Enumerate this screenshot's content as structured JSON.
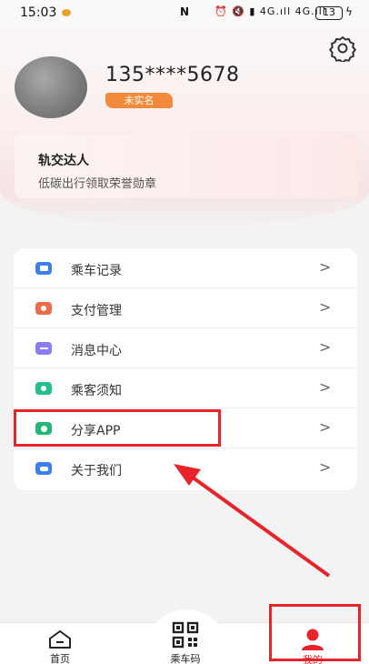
{
  "status_bar": {
    "time": "15:03",
    "nfc": "N",
    "icons": "⏰ 🔇 ▮ 4G.ıll 4G.ıll",
    "battery": "13",
    "bolt": "ϟ"
  },
  "profile": {
    "phone": "135****5678",
    "verify_badge": "未实名",
    "settings_icon": "gear-icon"
  },
  "honor_card": {
    "title": "轨交达人",
    "subtitle": "低碳出行领取荣誉勋章"
  },
  "menu": {
    "items": [
      {
        "label": "乘车记录",
        "icon": "ride-record-icon",
        "color": "#3b7ff0"
      },
      {
        "label": "支付管理",
        "icon": "payment-icon",
        "color": "#ee6b4a"
      },
      {
        "label": "消息中心",
        "icon": "message-icon",
        "color": "#8a7cf2"
      },
      {
        "label": "乘客须知",
        "icon": "notice-icon",
        "color": "#22c08a"
      },
      {
        "label": "分享APP",
        "icon": "share-icon",
        "color": "#22b87a"
      },
      {
        "label": "关于我们",
        "icon": "about-icon",
        "color": "#3b7ff0"
      }
    ],
    "chevron": ">"
  },
  "bottom_nav": {
    "home": "首页",
    "ride_code": "乘车码",
    "mine": "我的"
  },
  "colors": {
    "accent_red": "#e8242a",
    "badge_orange": "#f18b3b",
    "mine_active": "#e8242a"
  }
}
